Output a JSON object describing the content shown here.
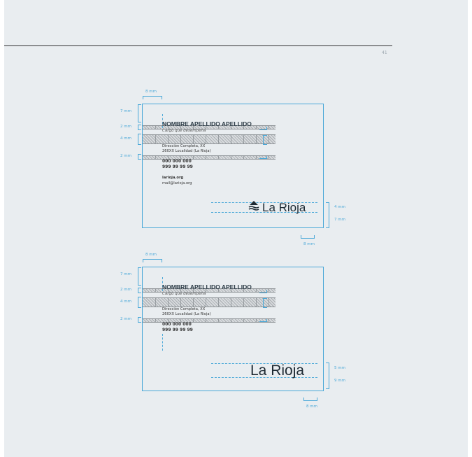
{
  "page": {
    "number": "41"
  },
  "cards": [
    {
      "name": "NOMBRE APELLIDO APELLIDO",
      "role": "Cargo que desempeña",
      "address1": "Dirección Completa, XX",
      "address2": "260XX Localidad (La Rioja)",
      "phone1": "000 000 000",
      "phone2": "999 99 99 99",
      "web": "larioja.org",
      "email": "mail@larioja.org",
      "logo_text": "La Rioja",
      "logo_icon": "crown-wave-icon",
      "dims": {
        "left_margin": "8 mm",
        "top_margin": "7 mm",
        "band_a": "2 mm",
        "band_b": "4 mm",
        "band_c": "2 mm",
        "logo_height": "4 mm",
        "logo_bottom": "7 mm",
        "right_margin": "8 mm"
      }
    },
    {
      "name": "NOMBRE APELLIDO APELLIDO",
      "role": "Cargo que desempeña",
      "address1": "Dirección Completa, XX",
      "address2": "260XX Localidad (La Rioja)",
      "phone1": "000 000 000",
      "phone2": "999 99 99 99",
      "logo_text": "La Rioja",
      "dims": {
        "left_margin": "8 mm",
        "top_margin": "7 mm",
        "band_a": "2 mm",
        "band_b": "4 mm",
        "band_c": "2 mm",
        "logo_height": "5 mm",
        "logo_bottom": "9 mm",
        "right_margin": "8 mm"
      }
    }
  ],
  "colors": {
    "guide": "#4aa8d8",
    "page": "#e9edf0",
    "text": "#2b2f33"
  }
}
